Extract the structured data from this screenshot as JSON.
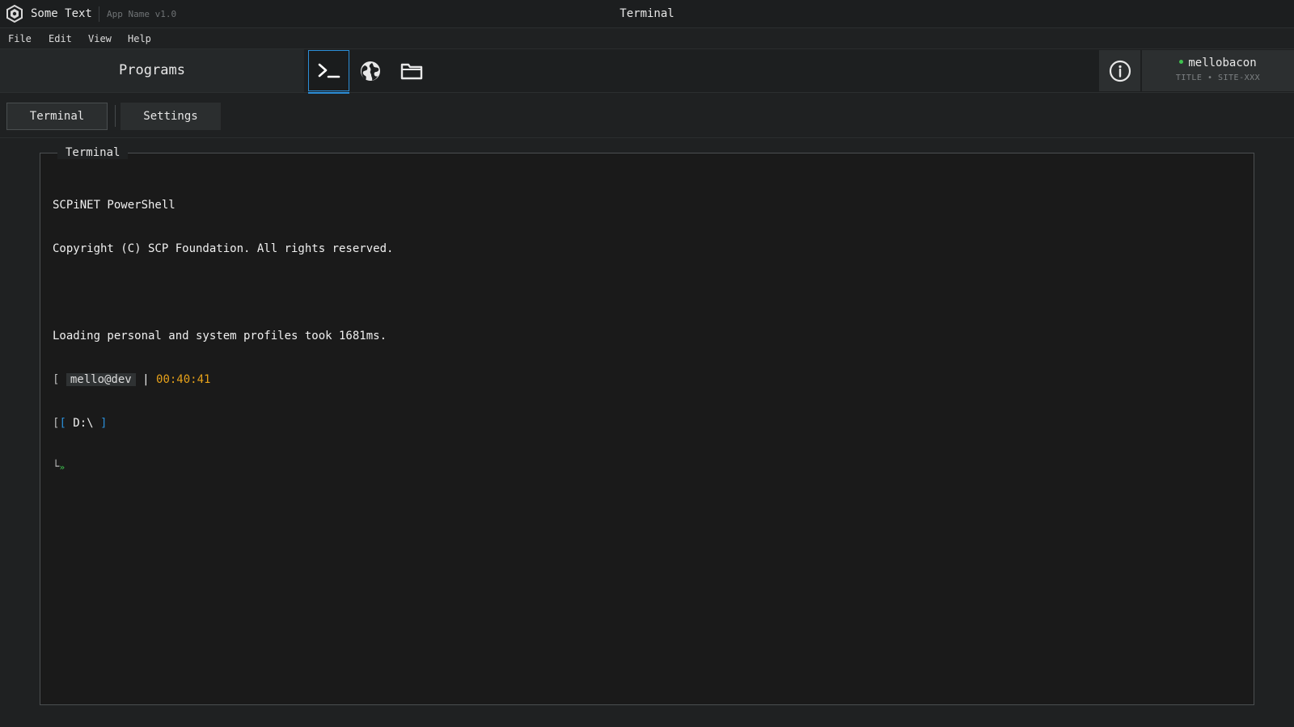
{
  "titlebar": {
    "app_text": "Some Text",
    "app_name": "App Name v1.0",
    "window_title": "Terminal"
  },
  "menu": {
    "items": [
      "File",
      "Edit",
      "View",
      "Help"
    ]
  },
  "programs": {
    "label": "Programs",
    "buttons": [
      {
        "icon": "terminal-icon",
        "active": true
      },
      {
        "icon": "globe-icon",
        "active": false
      },
      {
        "icon": "folder-icon",
        "active": false
      }
    ]
  },
  "user": {
    "name": "mellobacon",
    "subtitle": "TITLE • SITE-XXX",
    "status_color": "#3fc24f"
  },
  "tabs": [
    {
      "label": "Terminal",
      "active": true
    },
    {
      "label": "Settings",
      "active": false
    }
  ],
  "terminal": {
    "legend": "Terminal",
    "lines": [
      "SCPiNET PowerShell",
      "Copyright (C) SCP Foundation. All rights reserved.",
      "",
      "Loading personal and system profiles took 1681ms."
    ],
    "prompt": {
      "user": "mello@dev",
      "time": "00:40:41",
      "path": "D:\\",
      "arrow": "»"
    }
  },
  "colors": {
    "accent": "#2b8ed8",
    "time": "#e6a11a",
    "prompt_arrow": "#3fc24f",
    "background": "#1f2122",
    "terminal_background": "#1a1a1a"
  }
}
